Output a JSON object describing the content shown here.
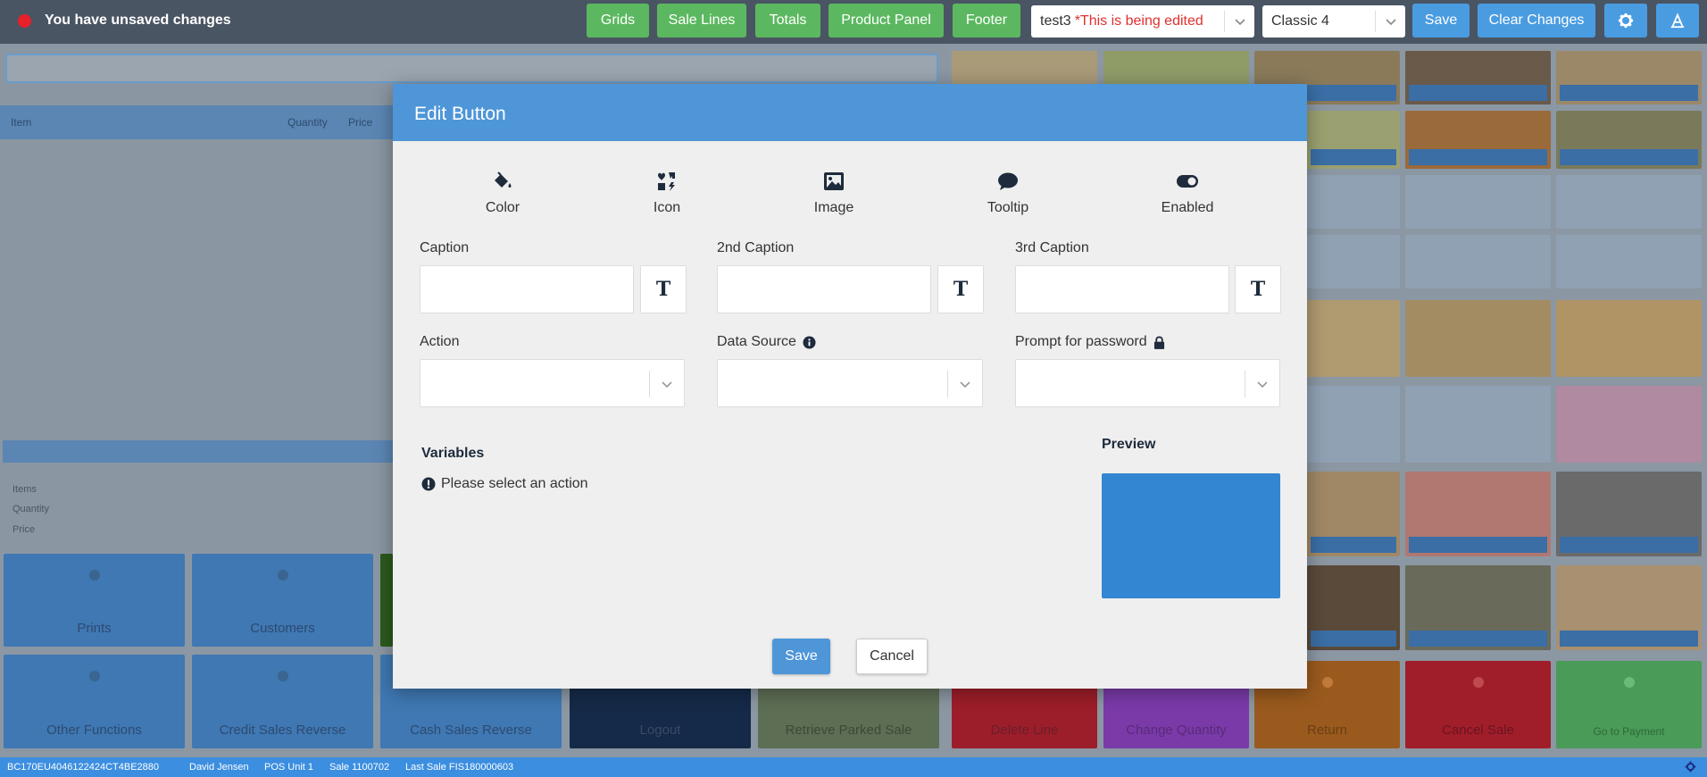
{
  "topbar": {
    "unsaved_text": "You have unsaved changes",
    "buttons": [
      "Grids",
      "Sale Lines",
      "Totals",
      "Product Panel",
      "Footer"
    ],
    "layout_select": {
      "value": "test3",
      "edited_note": "*This is being edited"
    },
    "theme_select": {
      "value": "Classic 4"
    },
    "save_label": "Save",
    "clear_label": "Clear Changes",
    "settings_icon": "gear-icon",
    "extra_icon": "pen-icon",
    "colors": {
      "bar": "#4a5563",
      "green": "#5cb860",
      "blue": "#4a9ce0",
      "unsaved": "#e8202a"
    }
  },
  "background": {
    "sale_lines_columns": [
      "Item",
      "Quantity",
      "Price"
    ],
    "totals_labels": [
      "Items",
      "Quantity",
      "Price"
    ],
    "function_tiles_row1": [
      "Prints",
      "Customers"
    ],
    "function_tiles_row2": [
      "Other Functions",
      "Credit Sales Reverse",
      "Cash Sales Reverse",
      "Logout",
      "Retrieve Parked Sale",
      "Delete Line",
      "Change Quantity",
      "Return",
      "Cancel Sale",
      "Go to Payment"
    ]
  },
  "statusbar": {
    "device_id": "BC170EU4046122424CT4BE2880",
    "user": "David Jensen",
    "pos_unit": "POS Unit 1",
    "sale": "Sale 1100702",
    "last_sale": "Last Sale FIS180000603"
  },
  "modal": {
    "title": "Edit Button",
    "modes": [
      {
        "label": "Color",
        "icon": "paint-bucket-icon"
      },
      {
        "label": "Icon",
        "icon": "icons-icon"
      },
      {
        "label": "Image",
        "icon": "image-icon"
      },
      {
        "label": "Tooltip",
        "icon": "comment-icon"
      },
      {
        "label": "Enabled",
        "icon": "toggle-on-icon"
      }
    ],
    "caption_label": "Caption",
    "caption_value": "",
    "caption2_label": "2nd Caption",
    "caption2_value": "",
    "caption3_label": "3rd Caption",
    "caption3_value": "",
    "text_format_glyph": "T",
    "action_label": "Action",
    "action_value": "",
    "datasource_label": "Data Source",
    "datasource_value": "",
    "password_label": "Prompt for password",
    "password_value": "",
    "variables_title": "Variables",
    "variables_hint": "Please select an action",
    "preview_title": "Preview",
    "preview_color": "#3386d1",
    "save_label": "Save",
    "cancel_label": "Cancel"
  }
}
